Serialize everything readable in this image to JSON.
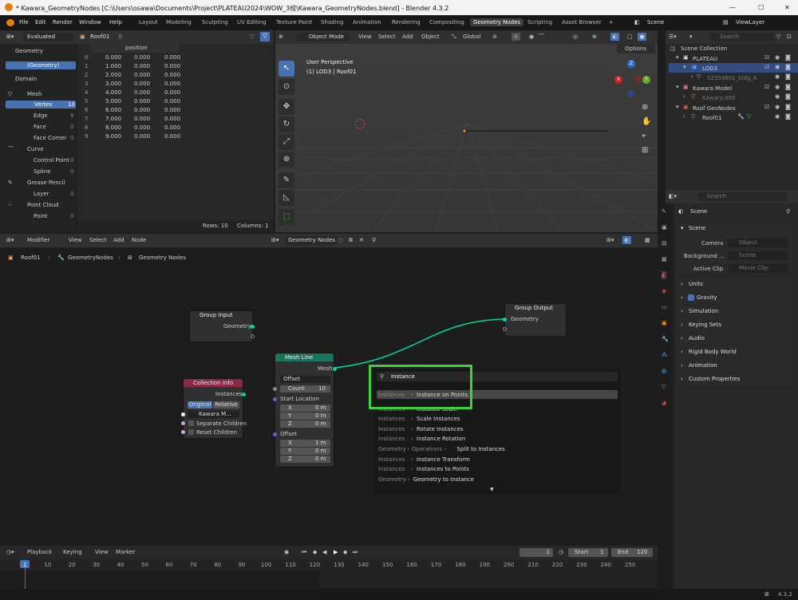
{
  "window": {
    "title": "* Kawara_GeometryNodes [C:\\Users\\osawa\\Documents\\Project\\PLATEAU2024\\WOW_3校\\Kawara_GeometryNodes.blend] - Blender 4.3.2",
    "min": "—",
    "max": "☐",
    "close": "✕"
  },
  "menu": {
    "file": "File",
    "edit": "Edit",
    "render": "Render",
    "window": "Window",
    "help": "Help"
  },
  "workspaces": [
    "Layout",
    "Modeling",
    "Sculpting",
    "UV Editing",
    "Texture Paint",
    "Shading",
    "Animation",
    "Rendering",
    "Compositing",
    "Geometry Nodes",
    "Scripting",
    "Asset Browser",
    "+"
  ],
  "scene": {
    "label": "Scene",
    "viewlayer": "ViewLayer"
  },
  "spreadsheet": {
    "mode": "Evaluated",
    "object": "Roof01",
    "col_header": "position",
    "sidebar": {
      "geometry_header": "Geometry",
      "geometry_item": "(Geometry)",
      "domain_header": "Domain",
      "mesh": "Mesh",
      "vertex": "Vertex",
      "vertex_count": "10",
      "edge": "Edge",
      "edge_count": "9",
      "face": "Face",
      "face_count": "0",
      "face_corner": "Face Corner",
      "face_corner_count": "0",
      "curve": "Curve",
      "control_point": "Control Point",
      "control_point_count": "0",
      "spline": "Spline",
      "spline_count": "0",
      "grease_pencil": "Grease Pencil",
      "layer": "Layer",
      "layer_count": "0",
      "point_cloud": "Point Cloud",
      "point": "Point",
      "point_count": "0"
    },
    "rows": [
      [
        "0",
        "0.000",
        "0.000",
        "0.000"
      ],
      [
        "1",
        "1.000",
        "0.000",
        "0.000"
      ],
      [
        "2",
        "2.000",
        "0.000",
        "0.000"
      ],
      [
        "3",
        "3.000",
        "0.000",
        "0.000"
      ],
      [
        "4",
        "4.000",
        "0.000",
        "0.000"
      ],
      [
        "5",
        "5.000",
        "0.000",
        "0.000"
      ],
      [
        "6",
        "6.000",
        "0.000",
        "0.000"
      ],
      [
        "7",
        "7.000",
        "0.000",
        "0.000"
      ],
      [
        "8",
        "8.000",
        "0.000",
        "0.000"
      ],
      [
        "9",
        "9.000",
        "0.000",
        "0.000"
      ]
    ],
    "footer_rows": "Rows: 10",
    "footer_cols": "Columns: 1"
  },
  "viewport": {
    "mode": "Object Mode",
    "view": "View",
    "select": "Select",
    "add": "Add",
    "object": "Object",
    "orientation": "Global",
    "options": "Options",
    "perspective": "User Perspective",
    "collection": "(1) LOD3 | Roof01",
    "axis_x": "X",
    "axis_y": "Y",
    "axis_z": "Z"
  },
  "outliner": {
    "search": "Search",
    "scene_collection": "Scene Collection",
    "items": [
      {
        "label": "PLATEAU"
      },
      {
        "label": "LOD3"
      },
      {
        "label": "52354601_bldg_6"
      },
      {
        "label": "Kawara Model"
      },
      {
        "label": "Kawara.005"
      },
      {
        "label": "Roof GeoNodes"
      },
      {
        "label": "Roof01"
      }
    ]
  },
  "properties": {
    "search": "Search",
    "scene": "Scene",
    "scene_section": "Scene",
    "camera_label": "Camera",
    "camera_value": "Object",
    "background_label": "Background ...",
    "background_value": "Scene",
    "active_clip_label": "Active Clip",
    "active_clip_value": "Movie Clip",
    "sections": [
      "Units",
      "Gravity",
      "Simulation",
      "Keying Sets",
      "Audio",
      "Rigid Body World",
      "Animation",
      "Custom Properties"
    ]
  },
  "node_editor": {
    "modifier": "Modifier",
    "view": "View",
    "select": "Select",
    "add": "Add",
    "node": "Node",
    "tree_name": "Geometry Nodes",
    "breadcrumb": [
      "Roof01",
      "GeometryNodes",
      "Geometry Nodes"
    ],
    "group_input": {
      "title": "Group Input",
      "output": "Geometry"
    },
    "group_output": {
      "title": "Group Output",
      "input": "Geometry"
    },
    "mesh_line": {
      "title": "Mesh Line",
      "output": "Mesh",
      "mode": "Offset",
      "count_label": "Count",
      "count_value": "10",
      "start_location": "Start Location",
      "offset": "Offset",
      "sx": "X",
      "sx_val": "0 m",
      "sy": "Y",
      "sy_val": "0 m",
      "sz": "Z",
      "sz_val": "0 m",
      "ox": "X",
      "ox_val": "1 m",
      "oy": "Y",
      "oy_val": "0 m",
      "oz": "Z",
      "oz_val": "0 m"
    },
    "collection_info": {
      "title": "Collection Info",
      "output": "Instances",
      "original": "Original",
      "relative": "Relative",
      "collection": "Kawara M...",
      "separate": "Separate Children",
      "reset": "Reset Children"
    }
  },
  "search_popup": {
    "query": "Instance",
    "results": [
      {
        "cat": "Instances",
        "sep": "›",
        "name": "Instance on Points"
      },
      {
        "cat": "Instances",
        "sep": "›",
        "name": "Instance Scale"
      },
      {
        "cat": "Instances",
        "sep": "›",
        "name": "Scale Instances"
      },
      {
        "cat": "Instances",
        "sep": "›",
        "name": "Rotate Instances"
      },
      {
        "cat": "Instances",
        "sep": "›",
        "name": "Instance Rotation"
      },
      {
        "cat": "Geometry",
        "sep": "› Operations ›",
        "name": "Split to Instances"
      },
      {
        "cat": "Instances",
        "sep": "›",
        "name": "Instance Transform"
      },
      {
        "cat": "Instances",
        "sep": "›",
        "name": "Instances to Points"
      },
      {
        "cat": "Geometry",
        "sep": "›",
        "name": "Geometry to Instance"
      }
    ]
  },
  "timeline": {
    "playback": "Playback",
    "keying": "Keying",
    "view": "View",
    "marker": "Marker",
    "current": "1",
    "start_label": "Start",
    "start": "1",
    "end_label": "End",
    "end": "120",
    "ticks": [
      "1",
      "10",
      "20",
      "30",
      "40",
      "50",
      "60",
      "70",
      "80",
      "90",
      "100",
      "110",
      "120",
      "130",
      "140",
      "150",
      "160",
      "170",
      "180",
      "190",
      "200",
      "210",
      "220",
      "230",
      "240",
      "250"
    ]
  },
  "status": {
    "version": "4.3.2"
  },
  "colors": {
    "accent": "#4772b3",
    "node_geo": "#00d6a3",
    "highlight": "#3fd13a",
    "collection_info": "#8a2a45",
    "mesh_line": "#1d725e"
  }
}
